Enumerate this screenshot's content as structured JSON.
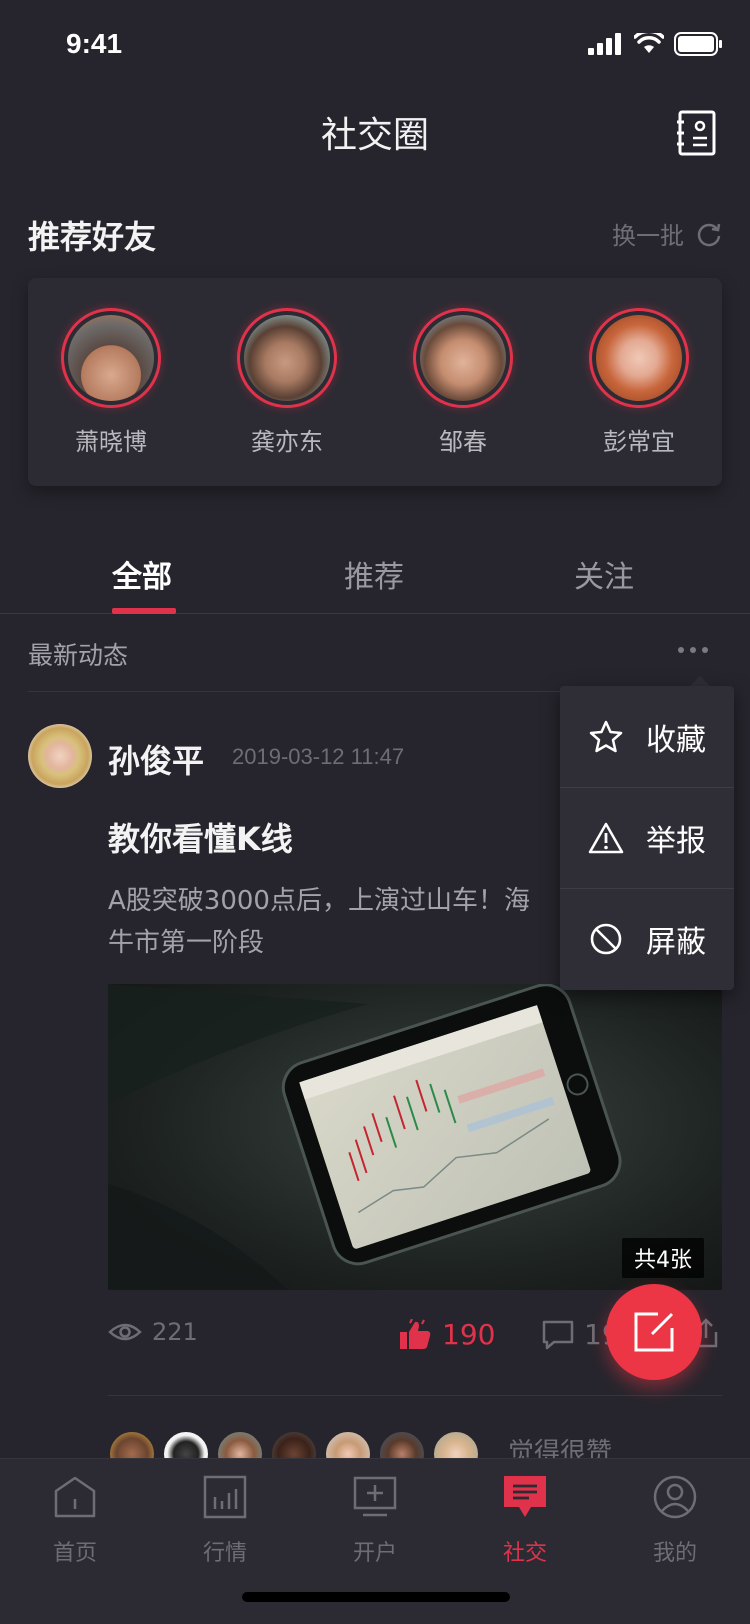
{
  "status_bar": {
    "time": "9:41"
  },
  "header": {
    "title": "社交圈",
    "contacts_icon": "contacts-book-icon"
  },
  "recommend": {
    "title": "推荐好友",
    "refresh_label": "换一批",
    "friends": [
      {
        "name": "萧晓博"
      },
      {
        "name": "龚亦东"
      },
      {
        "name": "邹春"
      },
      {
        "name": "彭常宜"
      }
    ]
  },
  "tabs": [
    {
      "label": "全部",
      "active": true
    },
    {
      "label": "推荐",
      "active": false
    },
    {
      "label": "关注",
      "active": false
    }
  ],
  "feed": {
    "section_label": "最新动态"
  },
  "post": {
    "author": "孙俊平",
    "time": "2019-03-12 11:47",
    "title": "教你看懂K线",
    "text_line1": "A股突破3000点后，上演过山车！海",
    "text_line2": "牛市第一阶段",
    "image_count_badge": "共4张",
    "views": "221",
    "likes": "190",
    "comments": "19",
    "likers_text": "觉得很赞"
  },
  "context_menu": {
    "items": [
      {
        "label": "收藏",
        "icon": "star-icon"
      },
      {
        "label": "举报",
        "icon": "warning-icon"
      },
      {
        "label": "屏蔽",
        "icon": "block-icon"
      }
    ]
  },
  "bottom_nav": [
    {
      "label": "首页",
      "icon": "home-icon",
      "active": false
    },
    {
      "label": "行情",
      "icon": "market-chart-icon",
      "active": false
    },
    {
      "label": "开户",
      "icon": "open-account-icon",
      "active": false
    },
    {
      "label": "社交",
      "icon": "social-chat-icon",
      "active": true
    },
    {
      "label": "我的",
      "icon": "profile-icon",
      "active": false
    }
  ],
  "colors": {
    "background": "#26252d",
    "card": "#2c2b33",
    "accent": "#e0334b",
    "fab": "#ec3545"
  }
}
